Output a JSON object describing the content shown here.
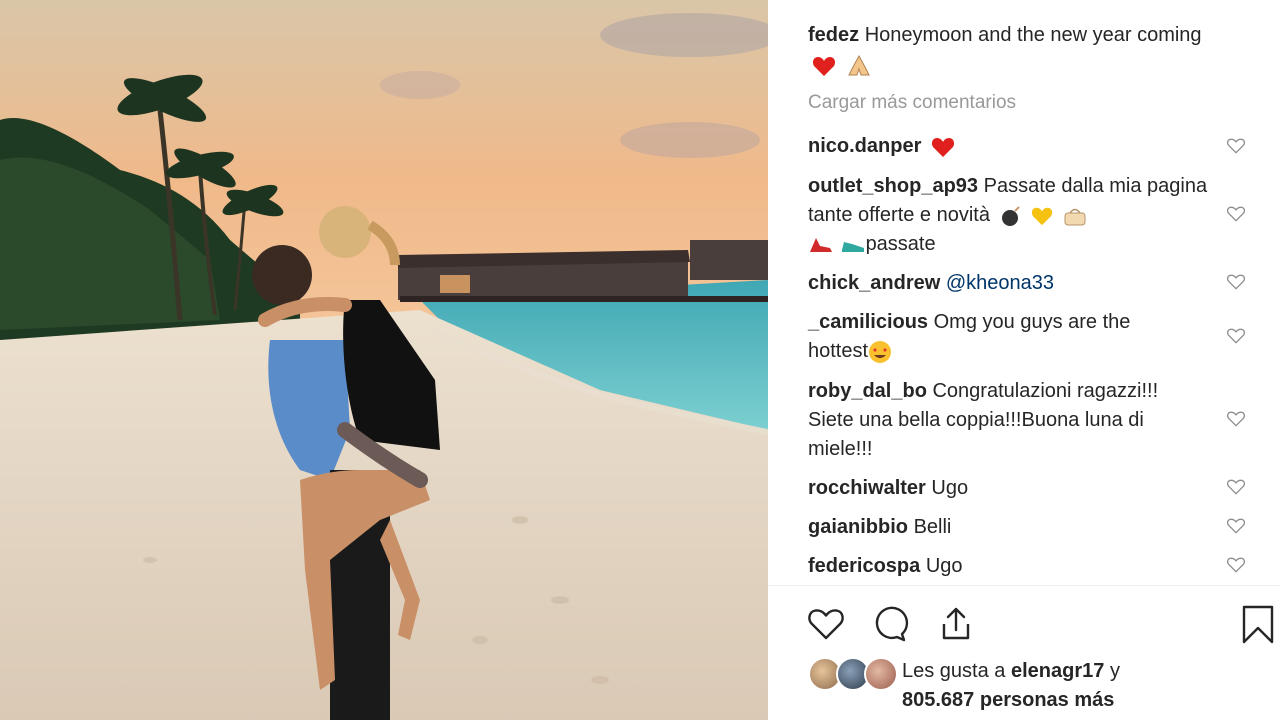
{
  "post": {
    "author": "fedez",
    "caption_text": "Honeymoon and the new year coming",
    "caption_emojis": [
      "red-heart-emoji",
      "folded-hands-emoji"
    ]
  },
  "load_more_label": "Cargar más comentarios",
  "comments": [
    {
      "user": "nico.danper",
      "text": "",
      "emojis": [
        "red-heart-emoji"
      ]
    },
    {
      "user": "outlet_shop_ap93",
      "text": "Passate dalla mia pagina tante offerte e novità",
      "emojis": [
        "bomb-emoji",
        "yellow-heart-emoji",
        "handbag-emoji",
        "high-heel-emoji",
        "sneaker-emoji"
      ],
      "tail": "passate"
    },
    {
      "user": "chick_andrew",
      "text": "@kheona33",
      "emojis": []
    },
    {
      "user": "_camilicious",
      "text": "Omg you guys are the hottest",
      "emojis": [
        "heart-eyes-emoji"
      ]
    },
    {
      "user": "roby_dal_bo",
      "text": "Congratulazioni ragazzi!!! Siete una bella coppia!!!Buona luna di miele!!!",
      "emojis": []
    },
    {
      "user": "rocchiwalter",
      "text": "Ugo",
      "emojis": []
    },
    {
      "user": "gaianibbio",
      "text": "Belli",
      "emojis": []
    },
    {
      "user": "federicospa",
      "text": "Ugo",
      "emojis": []
    }
  ],
  "likes": {
    "prefix": "Les gusta a",
    "liker": "elenagr17",
    "conjunction": "y",
    "count": "805.687",
    "suffix": "personas más"
  },
  "colors": {
    "username": "#262626",
    "muted": "#999999",
    "mention": "#003569",
    "heart_red": "#ed1c24"
  }
}
